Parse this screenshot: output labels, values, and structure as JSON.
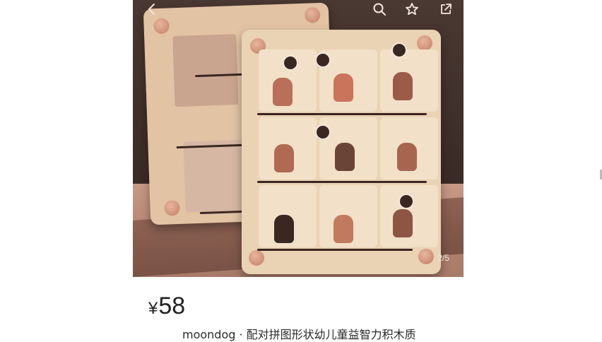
{
  "product": {
    "page_indicator": "2/5",
    "currency": "¥",
    "price": "58",
    "title": "moondog · 配对拼图形状幼儿童益智力积木质"
  },
  "icons": {
    "back": "chevron-left-icon",
    "search": "search-icon",
    "favorite": "star-icon",
    "share": "share-icon"
  },
  "colors": {
    "background": "#ffffff",
    "price_text": "#222222",
    "title_text": "#2a2a2a"
  }
}
